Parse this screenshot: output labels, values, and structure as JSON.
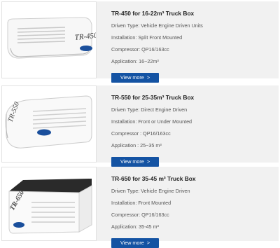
{
  "colors": {
    "accent": "#1453a3",
    "card_bg": "#f1f1f1",
    "title_text": "#222222",
    "spec_text": "#555555"
  },
  "products": [
    {
      "title": "TR-450 for 16-22m³ Truck Box",
      "specs": [
        "Driven Type: Vehicle Engine Driven Units",
        "Installation: Split Front Mounted",
        "Compressor: QP16/163cc",
        "Application: 16~22m³"
      ],
      "button_label": "View more",
      "button_icon": ">",
      "image_label": "TR-450"
    },
    {
      "title": "TR-550 for 25-35m³ Truck Box",
      "specs": [
        "Driven Type: Direct Engine Driven",
        "Installation: Front or Under Mounted",
        "Compressor : QP16/163cc",
        "Application : 25~35 m³"
      ],
      "button_label": "View more",
      "button_icon": ">",
      "image_label": "TR-550"
    },
    {
      "title": "TR-650 for 35-45 m³ Truck Box",
      "specs": [
        "Driven Type: Vehicle Engine Driven",
        "Installation: Front Mounted",
        "Compressor: QP16/163cc",
        "Application: 35-45 m³"
      ],
      "button_label": "View more",
      "button_icon": ">",
      "image_label": "TR-650"
    }
  ]
}
